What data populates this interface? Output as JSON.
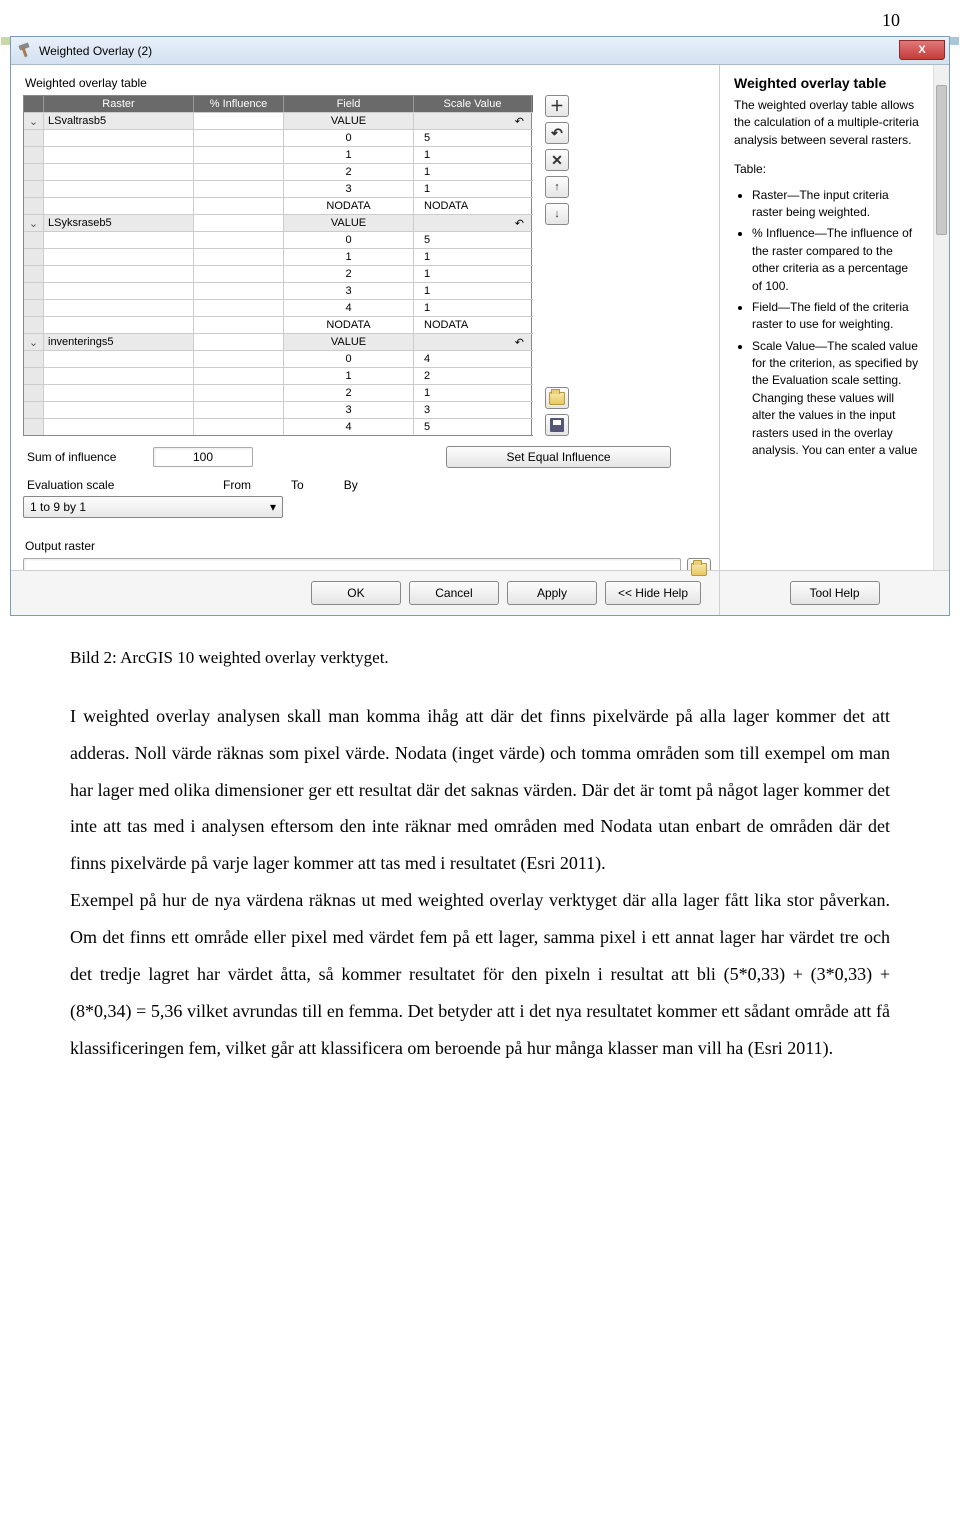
{
  "page_number": "10",
  "window": {
    "title": "Weighted Overlay (2)",
    "close": "X"
  },
  "panel": {
    "table_label": "Weighted overlay table",
    "headers": {
      "raster": "Raster",
      "influence": "% Influence",
      "field": "Field",
      "scale": "Scale Value"
    },
    "rows": [
      {
        "type": "raster",
        "expand": "⌄",
        "raster": "LSvaltrasb5",
        "influence": "",
        "field": "VALUE",
        "scale": "↶"
      },
      {
        "type": "data",
        "field": "0",
        "scale": "5"
      },
      {
        "type": "data",
        "field": "1",
        "scale": "1"
      },
      {
        "type": "data",
        "field": "2",
        "scale": "1"
      },
      {
        "type": "data",
        "field": "3",
        "scale": "1"
      },
      {
        "type": "data",
        "field": "NODATA",
        "scale": "NODATA"
      },
      {
        "type": "raster",
        "expand": "⌄",
        "raster": "LSyksraseb5",
        "influence": "",
        "field": "VALUE",
        "scale": "↶"
      },
      {
        "type": "data",
        "field": "0",
        "scale": "5"
      },
      {
        "type": "data",
        "field": "1",
        "scale": "1"
      },
      {
        "type": "data",
        "field": "2",
        "scale": "1"
      },
      {
        "type": "data",
        "field": "3",
        "scale": "1"
      },
      {
        "type": "data",
        "field": "4",
        "scale": "1"
      },
      {
        "type": "data",
        "field": "NODATA",
        "scale": "NODATA"
      },
      {
        "type": "raster",
        "expand": "⌄",
        "raster": "inventerings5",
        "influence": "",
        "field": "VALUE",
        "scale": "↶"
      },
      {
        "type": "data",
        "field": "0",
        "scale": "4"
      },
      {
        "type": "data",
        "field": "1",
        "scale": "2"
      },
      {
        "type": "data",
        "field": "2",
        "scale": "1"
      },
      {
        "type": "data",
        "field": "3",
        "scale": "3"
      },
      {
        "type": "data",
        "field": "4",
        "scale": "5"
      }
    ],
    "sum_label": "Sum of influence",
    "sum_value": "100",
    "set_equal": "Set Equal Influence",
    "eval_label": "Evaluation scale",
    "eval_fromto": {
      "from": "From",
      "to": "To",
      "by": "By"
    },
    "eval_value": "1  to  9  by  1",
    "output_label": "Output raster"
  },
  "side_buttons": {
    "add": "＋",
    "reset": "↶",
    "remove": "✕",
    "up": "↑",
    "down": "↓"
  },
  "lower_buttons": {
    "open": "open",
    "save": "save"
  },
  "buttons": {
    "ok": "OK",
    "cancel": "Cancel",
    "apply": "Apply",
    "hide": "<< Hide Help",
    "toolhelp": "Tool Help"
  },
  "help": {
    "title": "Weighted overlay table",
    "intro": "The weighted overlay table allows the calculation of a multiple-criteria analysis between several rasters.",
    "table_label": "Table:",
    "bullets": [
      "Raster—The input criteria raster being weighted.",
      "% Influence—The influence of the raster compared to the other criteria as a percentage of 100.",
      "Field—The field of the criteria raster to use for weighting.",
      "Scale Value—The scaled value for the criterion, as specified by the Evaluation scale setting. Changing these values will alter the values in the input rasters used in the overlay analysis. You can enter a value"
    ]
  },
  "caption": "Bild 2: ArcGIS 10 weighted overlay verktyget.",
  "body_p1": "I weighted overlay analysen skall man komma ihåg att där det finns pixelvärde på alla lager kommer det att adderas. Noll värde räknas som pixel värde. Nodata (inget värde) och tomma områden som till exempel om man har lager med olika dimensioner ger ett resultat där det saknas värden. Där det är tomt på något lager kommer det inte att tas med i analysen eftersom den inte räknar med områden med Nodata utan enbart de områden där det finns pixelvärde på varje lager kommer att tas med i resultatet (Esri 2011).",
  "body_p2": "Exempel på hur de nya värdena räknas ut med weighted overlay verktyget där alla lager fått lika stor påverkan. Om det finns ett område eller pixel med värdet fem på ett lager, samma pixel i ett annat lager har värdet tre och det tredje lagret har värdet åtta, så kommer resultatet för den pixeln i resultat att bli (5*0,33) + (3*0,33) + (8*0,34) = 5,36 vilket avrundas till en femma. Det betyder att i det nya resultatet kommer ett sådant område att få klassificeringen fem, vilket går att klassificera om beroende på hur många klasser man vill ha (Esri 2011)."
}
